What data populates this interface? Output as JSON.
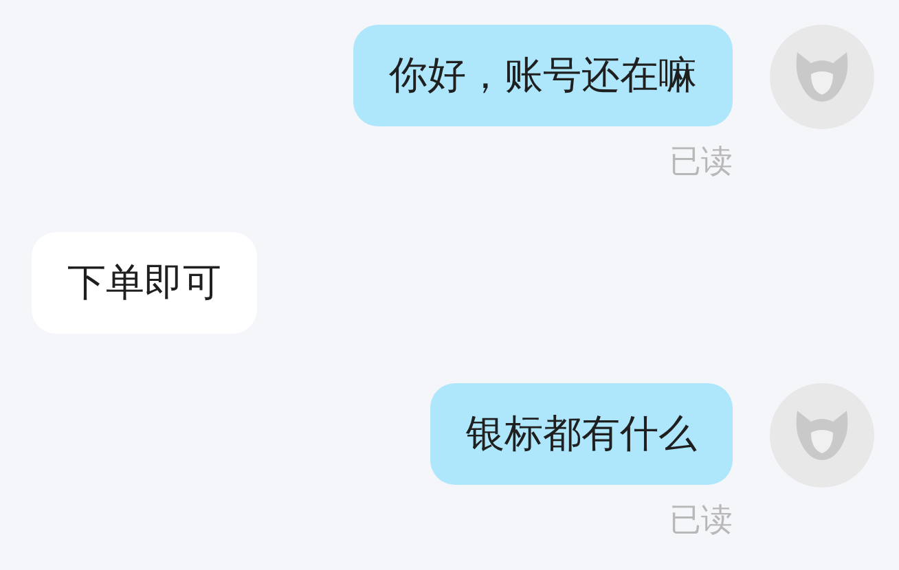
{
  "messages": [
    {
      "kind": "sent",
      "text": "你好，账号还在嘛",
      "status": "已读"
    },
    {
      "kind": "received",
      "text": "下单即可"
    },
    {
      "kind": "sent",
      "text": "银标都有什么",
      "status": "已读"
    }
  ]
}
